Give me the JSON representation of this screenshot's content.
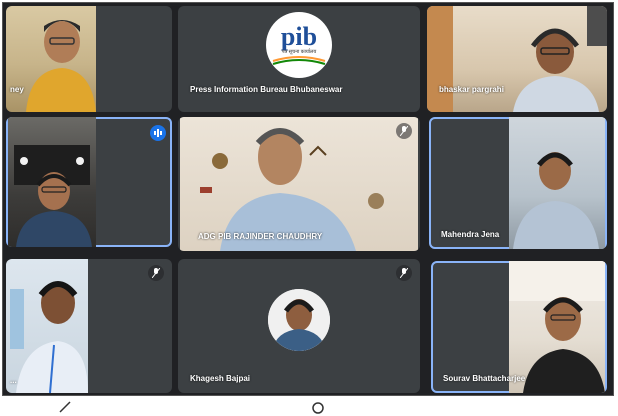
{
  "participants": {
    "t1": {
      "name": "ney",
      "avatar": "participant-avatar"
    },
    "t2": {
      "name": "Press Information Bureau Bhubaneswar",
      "logo_text": "pib",
      "logo_sub": "पत्र सूचना कार्यालय"
    },
    "t3": {
      "name": "bhaskar pargrahi"
    },
    "t4": {
      "name": ""
    },
    "t5": {
      "name": "ADG PIB RAJINDER CHAUDHRY"
    },
    "t6": {
      "name": "Mahendra Jena"
    },
    "t7": {
      "name": "..."
    },
    "t8": {
      "name": "Khagesh Bajpai"
    },
    "t9": {
      "name": "Sourav Bhattacharjee"
    }
  },
  "colors": {
    "stage_bg": "#202124",
    "tile_bg": "#3c4043",
    "active_border": "#8ab4f8",
    "speaking_indicator": "#1a73e8"
  },
  "icons": [
    "mic-off-icon",
    "speaking-icon"
  ]
}
